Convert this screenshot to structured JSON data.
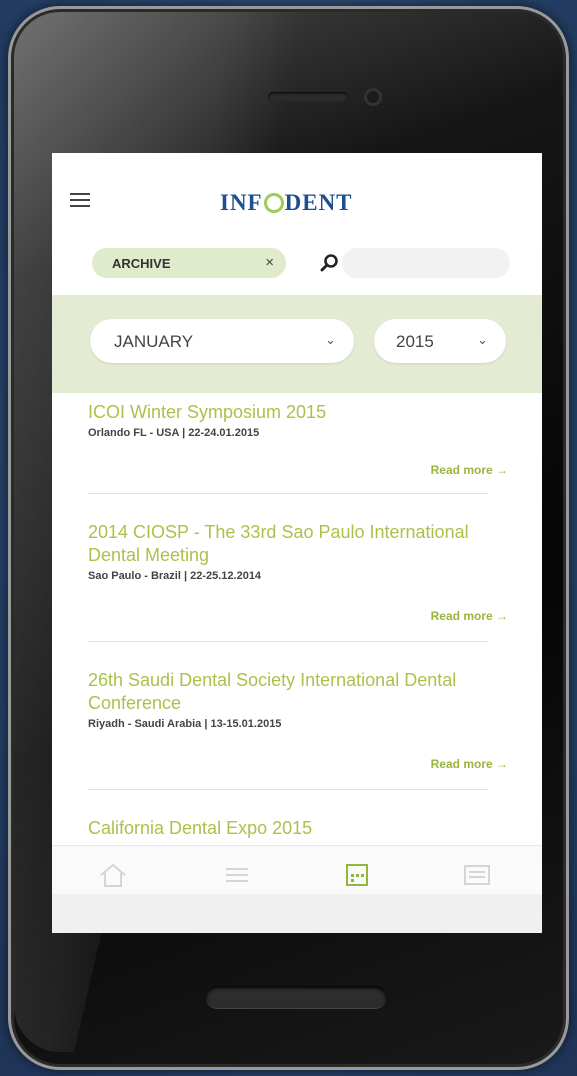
{
  "app": {
    "logo_text_left": "INF",
    "logo_text_right": "DENT"
  },
  "filter": {
    "archive_label": "ARCHIVE",
    "archive_clear": "×",
    "month": "JANUARY",
    "year": "2015",
    "chevron": "⌄"
  },
  "events": [
    {
      "title": "ICOI Winter Symposium 2015",
      "meta": "Orlando FL - USA  |  22-24.01.2015",
      "read_more": "Read more →"
    },
    {
      "title": "2014 CIOSP - The 33rd Sao Paulo International Dental Meeting",
      "meta": "Sao Paulo - Brazil  |  22-25.12.2014",
      "read_more": "Read more →"
    },
    {
      "title": "26th Saudi Dental Society International Dental Conference",
      "meta": "Riyadh - Saudi Arabia  |  13-15.01.2015",
      "read_more": "Read more →"
    },
    {
      "title": "California Dental Expo 2015"
    }
  ],
  "tabbar": {
    "items": [
      {
        "icon": "home-icon",
        "active": false
      },
      {
        "icon": "list-icon",
        "active": false
      },
      {
        "icon": "calendar-icon",
        "active": true
      },
      {
        "icon": "newspaper-icon",
        "active": false
      }
    ]
  },
  "colors": {
    "accent_green": "#a9c24a",
    "filter_band": "#e3ecd2",
    "logo_blue": "#1f4f8f"
  }
}
